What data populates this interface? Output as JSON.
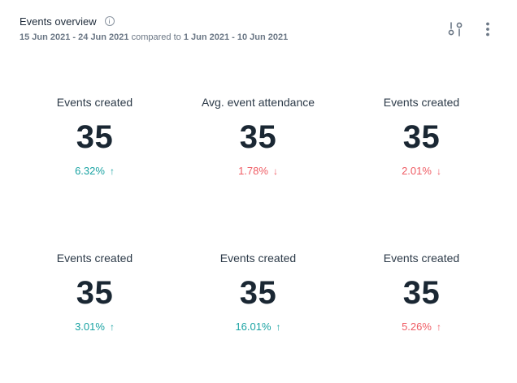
{
  "header": {
    "title": "Events overview",
    "date_range_current": "15 Jun 2021 - 24 Jun 2021",
    "compared_to_text": "compared to",
    "date_range_previous": "1 Jun 2021 - 10 Jun 2021",
    "icons": {
      "info": "info-icon",
      "filter": "sliders-icon",
      "more": "more-vertical-icon"
    }
  },
  "colors": {
    "positive": "#1aa3a3",
    "negative": "#ef5b63",
    "value": "#1a2733"
  },
  "metrics": [
    {
      "label": "Events created",
      "value": "35",
      "change": "6.32%",
      "arrow": "↑",
      "status": "up"
    },
    {
      "label": "Avg. event attendance",
      "value": "35",
      "change": "1.78%",
      "arrow": "↓",
      "status": "down"
    },
    {
      "label": "Events created",
      "value": "35",
      "change": "2.01%",
      "arrow": "↓",
      "status": "down"
    },
    {
      "label": "Events created",
      "value": "35",
      "change": "3.01%",
      "arrow": "↑",
      "status": "up"
    },
    {
      "label": "Events created",
      "value": "35",
      "change": "16.01%",
      "arrow": "↑",
      "status": "up"
    },
    {
      "label": "Events created",
      "value": "35",
      "change": "5.26%",
      "arrow": "↑",
      "status": "down"
    }
  ]
}
